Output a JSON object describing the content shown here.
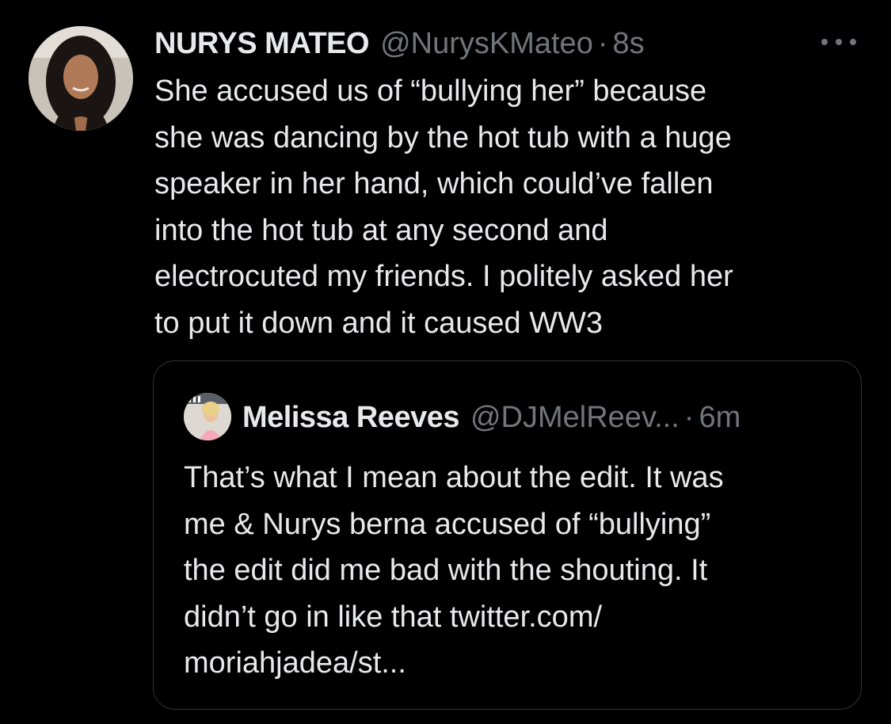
{
  "tweet": {
    "display_name": "NURYS MATEO",
    "handle": "@NurysKMateo",
    "separator": "·",
    "time": "8s",
    "text": "She accused us of “bullying her” because\nshe was dancing by the hot tub with a huge\nspeaker in her hand, which could’ve fallen\ninto the hot tub at any second and\nelectrocuted my friends. I politely asked her\nto put it down and it caused WW3",
    "more_icon": "ellipsis-icon"
  },
  "quote": {
    "display_name": "Melissa Reeves",
    "handle": "@DJMelReev...",
    "separator": "·",
    "time": "6m",
    "text": "That’s what I mean about the edit. It was\nme & Nurys berna accused of “bullying”\nthe edit did me bad with the shouting. It\ndidn’t go in like that twitter.com/\nmoriahjadea/st..."
  },
  "colors": {
    "background": "#000000",
    "primary_text": "#e7e9ea",
    "secondary_text": "#71767b",
    "border": "#2f3336"
  }
}
